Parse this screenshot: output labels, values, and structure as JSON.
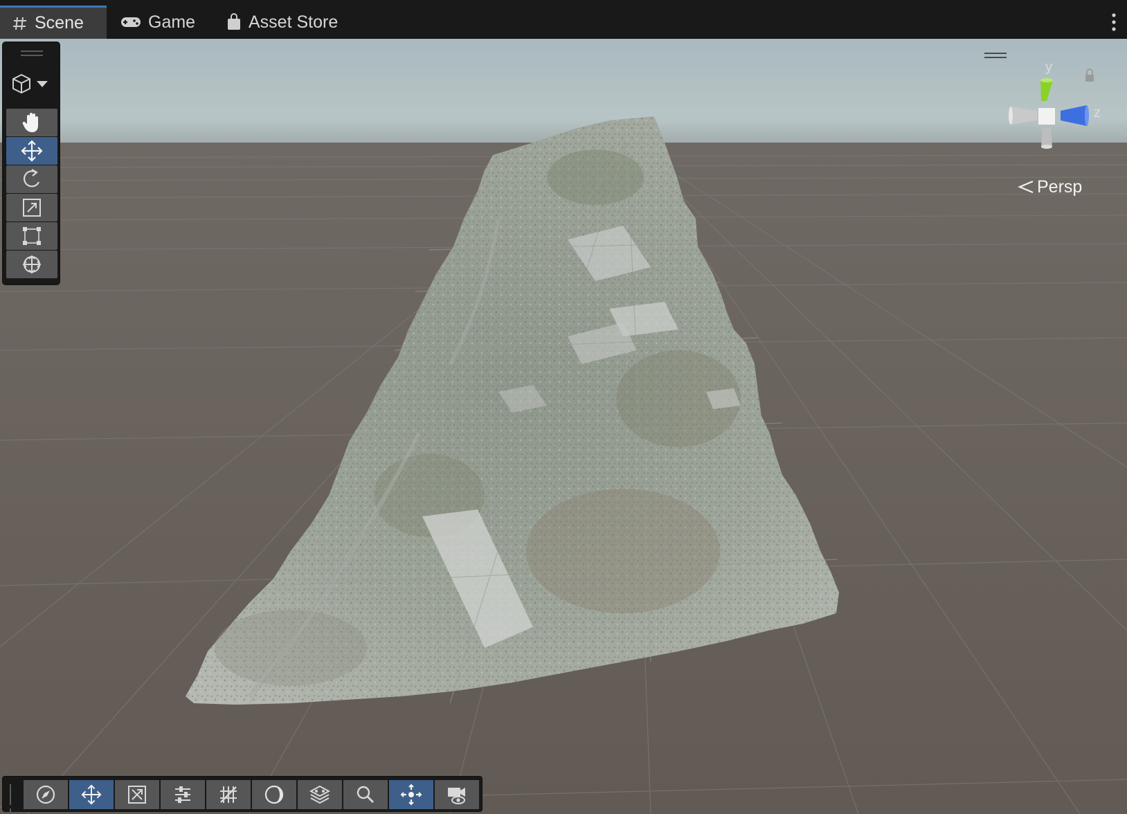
{
  "tabs": [
    {
      "label": "Scene",
      "icon": "hash-icon",
      "active": true
    },
    {
      "label": "Game",
      "icon": "gamepad-icon",
      "active": false
    },
    {
      "label": "Asset Store",
      "icon": "shopping-bag-icon",
      "active": false
    }
  ],
  "gizmo": {
    "axis_y": "y",
    "axis_z": "z",
    "projection": "Persp"
  },
  "tools": [
    {
      "name": "view-tool",
      "icon": "hand-icon",
      "active": false
    },
    {
      "name": "move-tool",
      "icon": "move-arrows-icon",
      "active": true
    },
    {
      "name": "rotate-tool",
      "icon": "rotate-icon",
      "active": false
    },
    {
      "name": "scale-tool",
      "icon": "scale-icon",
      "active": false
    },
    {
      "name": "rect-tool",
      "icon": "rect-transform-icon",
      "active": false
    },
    {
      "name": "transform-tool",
      "icon": "transform-icon",
      "active": false
    }
  ],
  "overlay_tools": [
    {
      "icon": "compass-icon",
      "active": false
    },
    {
      "icon": "move-arrows-icon",
      "active": true
    },
    {
      "icon": "scale-crossed-icon",
      "active": false
    },
    {
      "icon": "sliders-icon",
      "active": false
    },
    {
      "icon": "grid-snap-icon",
      "active": false
    },
    {
      "icon": "shading-sphere-icon",
      "active": false
    },
    {
      "icon": "layers-icon",
      "active": false
    },
    {
      "icon": "search-icon",
      "active": false
    },
    {
      "icon": "pivot-icon",
      "active": true
    },
    {
      "icon": "camera-visibility-icon",
      "active": false
    }
  ],
  "colors": {
    "accent": "#3a79bb",
    "active_tool": "#3e5f8a",
    "axis_y": "#7ed321",
    "axis_z": "#3b73e8",
    "ground": "#6b635c"
  }
}
